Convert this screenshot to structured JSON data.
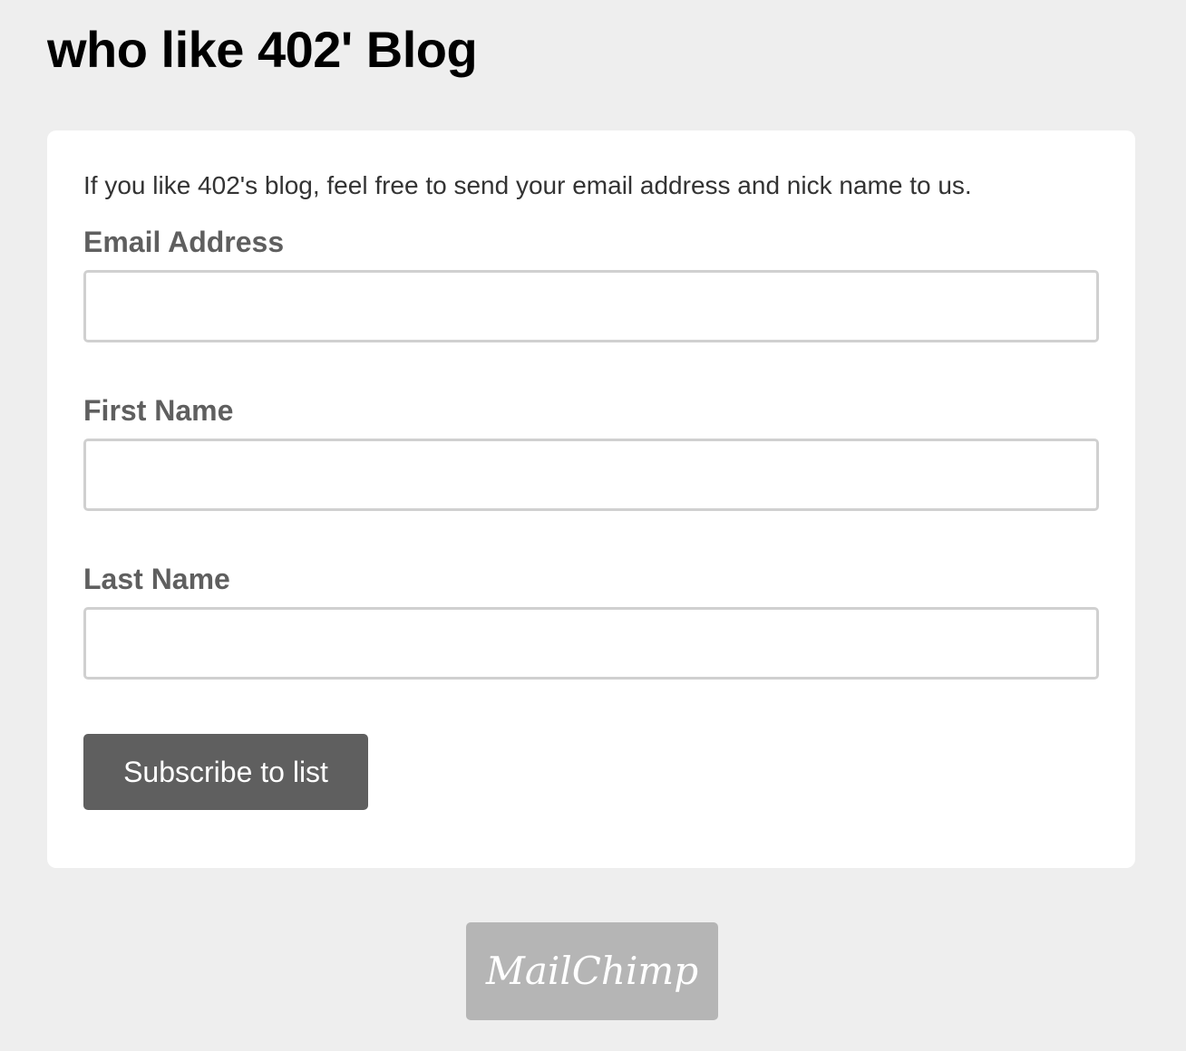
{
  "header": {
    "title": "who like 402' Blog"
  },
  "form": {
    "intro": "If you like 402's blog, feel free to send your email address and nick name to us.",
    "fields": [
      {
        "label": "Email Address",
        "value": ""
      },
      {
        "label": "First Name",
        "value": ""
      },
      {
        "label": "Last Name",
        "value": ""
      }
    ],
    "submit_label": "Subscribe to list"
  },
  "footer": {
    "badge_text": "MailChimp"
  },
  "colors": {
    "background": "#eeeeee",
    "card": "#ffffff",
    "button": "#5f5f5f",
    "label": "#5f5f5f",
    "input_border": "#d0d0d0",
    "badge": "#b5b5b5"
  }
}
